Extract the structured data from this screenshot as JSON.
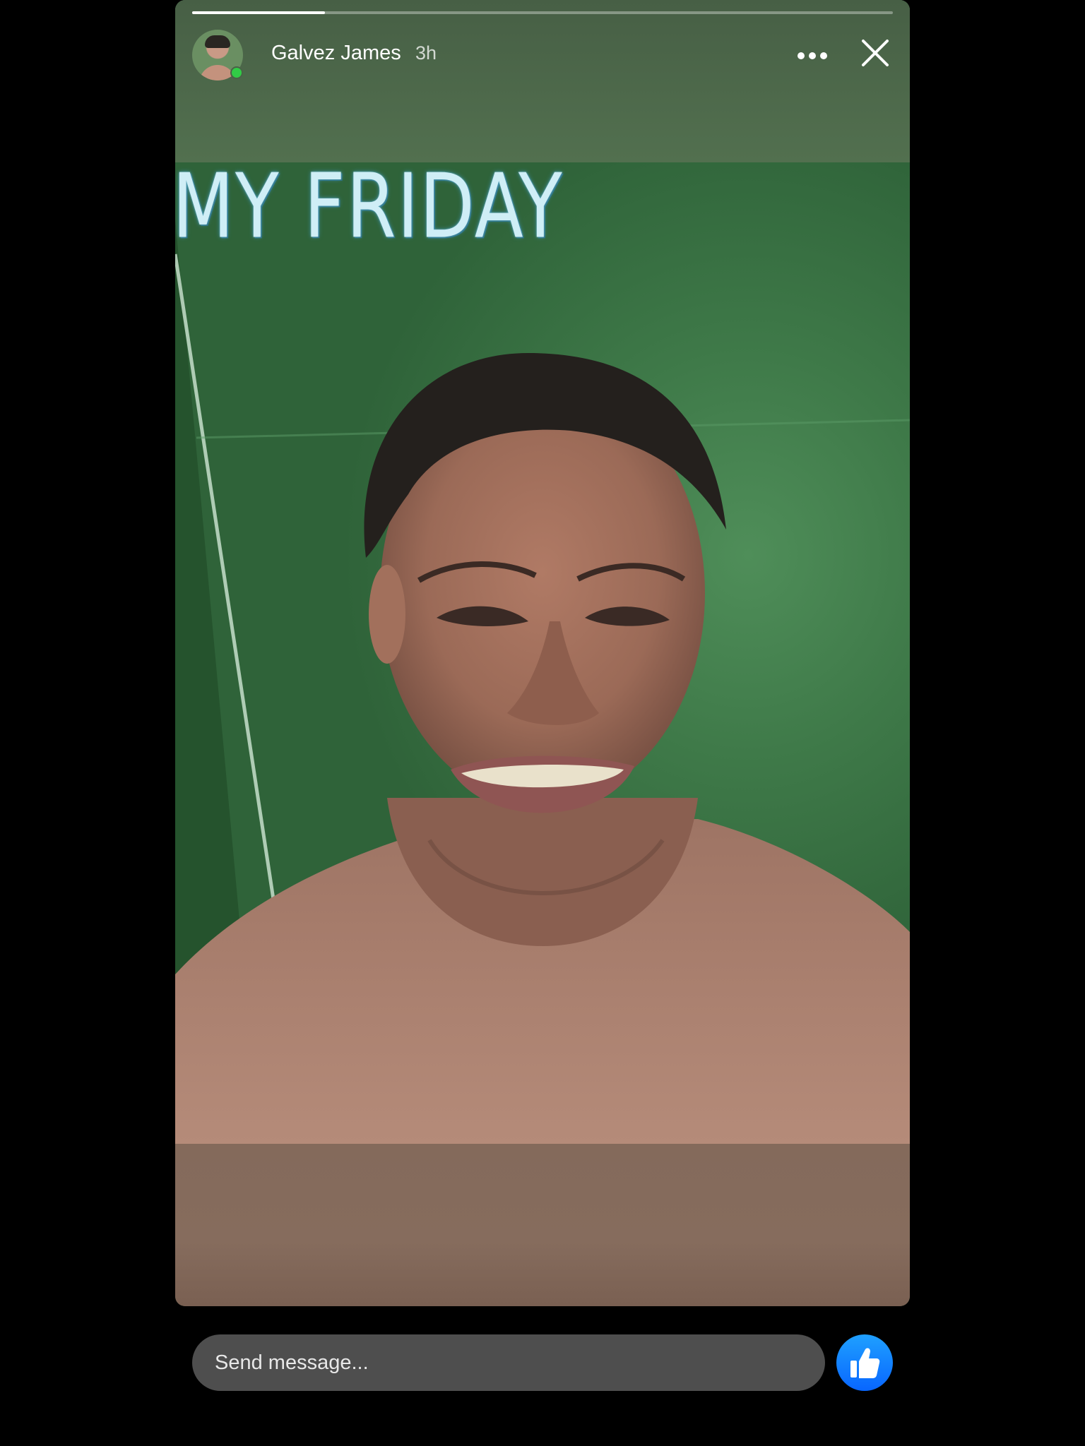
{
  "story": {
    "author_name": "Galvez James",
    "posted_time": "3h",
    "caption_text": "MY FRIDAY",
    "progress": 0.19,
    "author_online": true
  },
  "header": {
    "more_icon": "more-horizontal-icon",
    "close_icon": "close-icon"
  },
  "composer": {
    "placeholder": "Send message...",
    "value": ""
  },
  "actions": {
    "like_icon": "thumbs-up-icon"
  },
  "colors": {
    "page_background": "#000000",
    "like_button": "#0866ff",
    "online_indicator": "#31cc46",
    "composer_background": "#4e4e4e"
  }
}
